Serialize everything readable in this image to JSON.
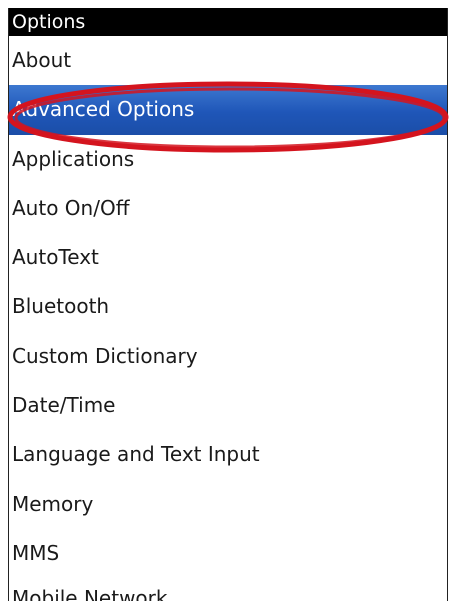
{
  "title": "Options",
  "items": [
    {
      "label": "About",
      "selected": false
    },
    {
      "label": "Advanced Options",
      "selected": true
    },
    {
      "label": "Applications",
      "selected": false
    },
    {
      "label": "Auto On/Off",
      "selected": false
    },
    {
      "label": "AutoText",
      "selected": false
    },
    {
      "label": "Bluetooth",
      "selected": false
    },
    {
      "label": "Custom Dictionary",
      "selected": false
    },
    {
      "label": "Date/Time",
      "selected": false
    },
    {
      "label": "Language and Text Input",
      "selected": false
    },
    {
      "label": "Memory",
      "selected": false
    },
    {
      "label": "MMS",
      "selected": false
    }
  ],
  "partial_item": {
    "label": "Mobile Network"
  },
  "colors": {
    "selection": "#1f56b8",
    "highlight_ring": "#d4141e",
    "titlebar": "#000000"
  }
}
